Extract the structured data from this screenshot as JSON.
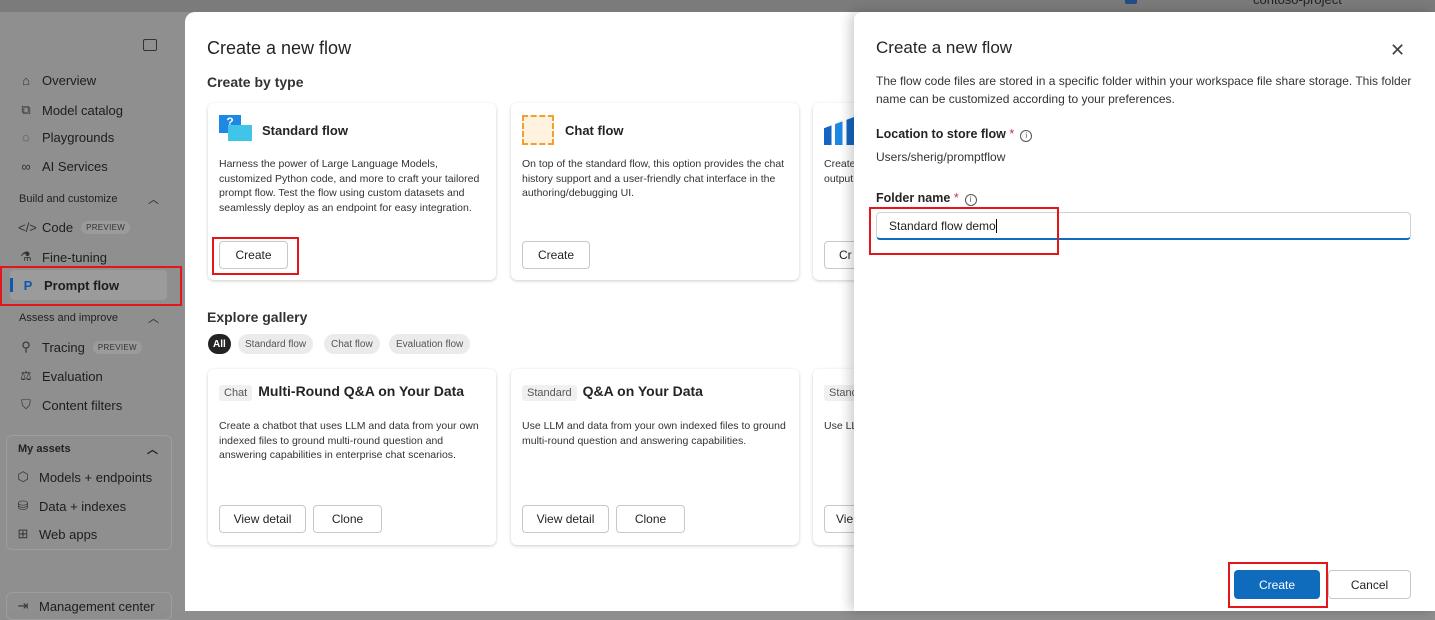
{
  "topbar": {
    "project": "contoso-project"
  },
  "sidebar": {
    "items": [
      {
        "label": "Overview",
        "icon": "home-icon"
      },
      {
        "label": "Model catalog",
        "icon": "cube-icon"
      },
      {
        "label": "Playgrounds",
        "icon": "chat-icon"
      },
      {
        "label": "AI Services",
        "icon": "link-icon"
      }
    ],
    "build_section": "Build and customize",
    "build_items": [
      {
        "label": "Code",
        "badge": "PREVIEW",
        "icon": "code-icon"
      },
      {
        "label": "Fine-tuning",
        "icon": "beaker-icon"
      },
      {
        "label": "Prompt flow",
        "icon": "prompt-flow-icon"
      }
    ],
    "assess_section": "Assess and improve",
    "assess_items": [
      {
        "label": "Tracing",
        "badge": "PREVIEW",
        "icon": "tracing-icon"
      },
      {
        "label": "Evaluation",
        "icon": "scale-icon"
      },
      {
        "label": "Content filters",
        "icon": "shield-icon"
      }
    ],
    "assets_section": "My assets",
    "asset_items": [
      {
        "label": "Models + endpoints",
        "icon": "cube-icon"
      },
      {
        "label": "Data + indexes",
        "icon": "database-icon"
      },
      {
        "label": "Web apps",
        "icon": "apps-icon"
      }
    ],
    "management": "Management center"
  },
  "modal": {
    "title": "Create a new flow",
    "by_type": "Create by type",
    "types": [
      {
        "title": "Standard flow",
        "desc": "Harness the power of Large Language Models, customized Python code, and more to craft your tailored prompt flow. Test the flow using custom datasets and seamlessly deploy as an endpoint for easy integration.",
        "button": "Create"
      },
      {
        "title": "Chat flow",
        "desc": "On top of the standard flow, this option provides the chat history support and a user-friendly chat interface in the authoring/debugging UI.",
        "button": "Create"
      },
      {
        "title": "",
        "desc": "Create\noutput",
        "button": "Cr"
      }
    ],
    "gallery": "Explore gallery",
    "filters": [
      "All",
      "Standard flow",
      "Chat flow",
      "Evaluation flow"
    ],
    "gallery_cards": [
      {
        "tag": "Chat",
        "title": "Multi-Round Q&A on Your Data",
        "desc": "Create a chatbot that uses LLM and data from your own indexed files to ground multi-round question and answering capabilities in enterprise chat scenarios.",
        "view": "View detail",
        "clone": "Clone"
      },
      {
        "tag": "Standard",
        "title": "Q&A on Your Data",
        "desc": "Use LLM and data from your own indexed files to ground multi-round question and answering capabilities.",
        "view": "View detail",
        "clone": "Clone"
      },
      {
        "tag": "Stand",
        "title": "",
        "desc": "Use LL",
        "view": "Vie"
      }
    ]
  },
  "panel": {
    "title": "Create a new flow",
    "desc": "The flow code files are stored in a specific folder within your workspace file share storage. This folder name can be customized according to your preferences.",
    "location_label": "Location to store flow",
    "location_value": "Users/sherig/promptflow",
    "folder_label": "Folder name",
    "folder_value": "Standard flow demo",
    "required": "*",
    "create": "Create",
    "cancel": "Cancel"
  },
  "colors": {
    "accent": "#0f6cbd",
    "highlight": "#e3161b"
  }
}
